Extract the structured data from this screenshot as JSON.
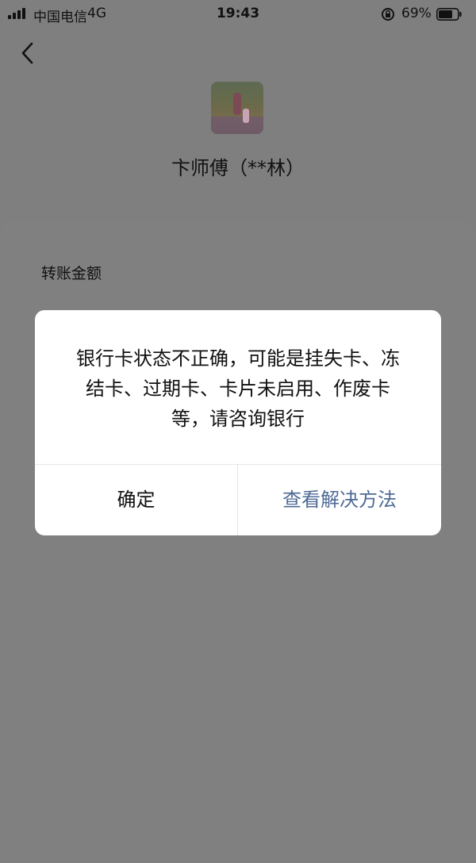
{
  "status_bar": {
    "carrier": "中国电信",
    "network": "4G",
    "time": "19:43",
    "battery_percent": "69%"
  },
  "nav": {
    "back_icon": "chevron-left-icon"
  },
  "payee": {
    "name": "卞师傅（**林）"
  },
  "form": {
    "amount_label": "转账金额"
  },
  "dialog": {
    "message": "银行卡状态不正确，可能是挂失卡、冻结卡、过期卡、卡片未启用、作废卡等，请咨询银行",
    "confirm_label": "确定",
    "solution_label": "查看解决方法"
  },
  "colors": {
    "overlay_bg": "#7f7f7f",
    "dialog_bg": "#ffffff",
    "link": "#4f6a96"
  }
}
